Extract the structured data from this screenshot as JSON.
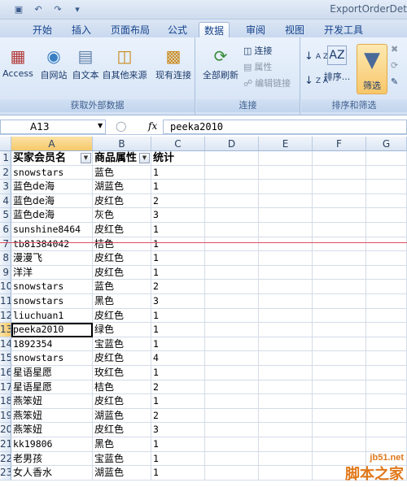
{
  "window": {
    "title": "ExportOrderDet"
  },
  "tabs": [
    "开始",
    "插入",
    "页面布局",
    "公式",
    "数据",
    "审阅",
    "视图",
    "开发工具"
  ],
  "ribbon": {
    "external": {
      "label": "获取外部数据",
      "buttons": [
        "Access",
        "自网站",
        "自文本",
        "自其他来源",
        "现有连接"
      ]
    },
    "connections": {
      "label": "连接",
      "refresh": "全部刷新",
      "items": [
        "连接",
        "属性",
        "编辑链接"
      ]
    },
    "sort": {
      "label": "排序和筛选",
      "sort_btn": "排序...",
      "filter_btn": "筛选"
    }
  },
  "formula_bar": {
    "name_box": "A13",
    "fx": "fx",
    "content": "peeka2010"
  },
  "columns": [
    "A",
    "B",
    "C",
    "D",
    "E",
    "F",
    "G"
  ],
  "header_row": [
    "买家会员名",
    "商品属性",
    "统计"
  ],
  "rows": [
    {
      "n": "2",
      "a": "snowstars",
      "b": "蓝色",
      "c": "1"
    },
    {
      "n": "3",
      "a": "蓝色de海",
      "b": "湖蓝色",
      "c": "1"
    },
    {
      "n": "4",
      "a": "蓝色de海",
      "b": "皮红色",
      "c": "2"
    },
    {
      "n": "5",
      "a": "蓝色de海",
      "b": "灰色",
      "c": "3"
    },
    {
      "n": "6",
      "a": "sunshine8464",
      "b": "皮红色",
      "c": "1"
    },
    {
      "n": "7",
      "a": "tb81384042",
      "b": "桔色",
      "c": "1"
    },
    {
      "n": "8",
      "a": "漫漫飞",
      "b": "皮红色",
      "c": "1"
    },
    {
      "n": "9",
      "a": "洋洋",
      "b": "皮红色",
      "c": "1"
    },
    {
      "n": "10",
      "a": "snowstars",
      "b": "蓝色",
      "c": "2"
    },
    {
      "n": "11",
      "a": "snowstars",
      "b": "黑色",
      "c": "3"
    },
    {
      "n": "12",
      "a": "liuchuan1",
      "b": "皮红色",
      "c": "1"
    },
    {
      "n": "13",
      "a": "peeka2010",
      "b": "绿色",
      "c": "1"
    },
    {
      "n": "14",
      "a": "1892354",
      "b": "宝蓝色",
      "c": "1"
    },
    {
      "n": "15",
      "a": "snowstars",
      "b": "皮红色",
      "c": "4"
    },
    {
      "n": "16",
      "a": "星语星愿",
      "b": "玫红色",
      "c": "1"
    },
    {
      "n": "17",
      "a": "星语星愿",
      "b": "桔色",
      "c": "2"
    },
    {
      "n": "18",
      "a": "燕笨妞",
      "b": "皮红色",
      "c": "1"
    },
    {
      "n": "19",
      "a": "燕笨妞",
      "b": "湖蓝色",
      "c": "2"
    },
    {
      "n": "20",
      "a": "燕笨妞",
      "b": "皮红色",
      "c": "3"
    },
    {
      "n": "21",
      "a": "kk19806",
      "b": "黑色",
      "c": "1"
    },
    {
      "n": "22",
      "a": "老男孩",
      "b": "宝蓝色",
      "c": "1"
    },
    {
      "n": "23",
      "a": "女人香水",
      "b": "湖蓝色",
      "c": "1"
    }
  ],
  "watermark": {
    "line1": "jb51.net",
    "line2": "脚本之家"
  },
  "colors": {
    "ribbon_text": "#15428b",
    "selected_header": "#f6c86a",
    "accent_line": "#e05060"
  }
}
